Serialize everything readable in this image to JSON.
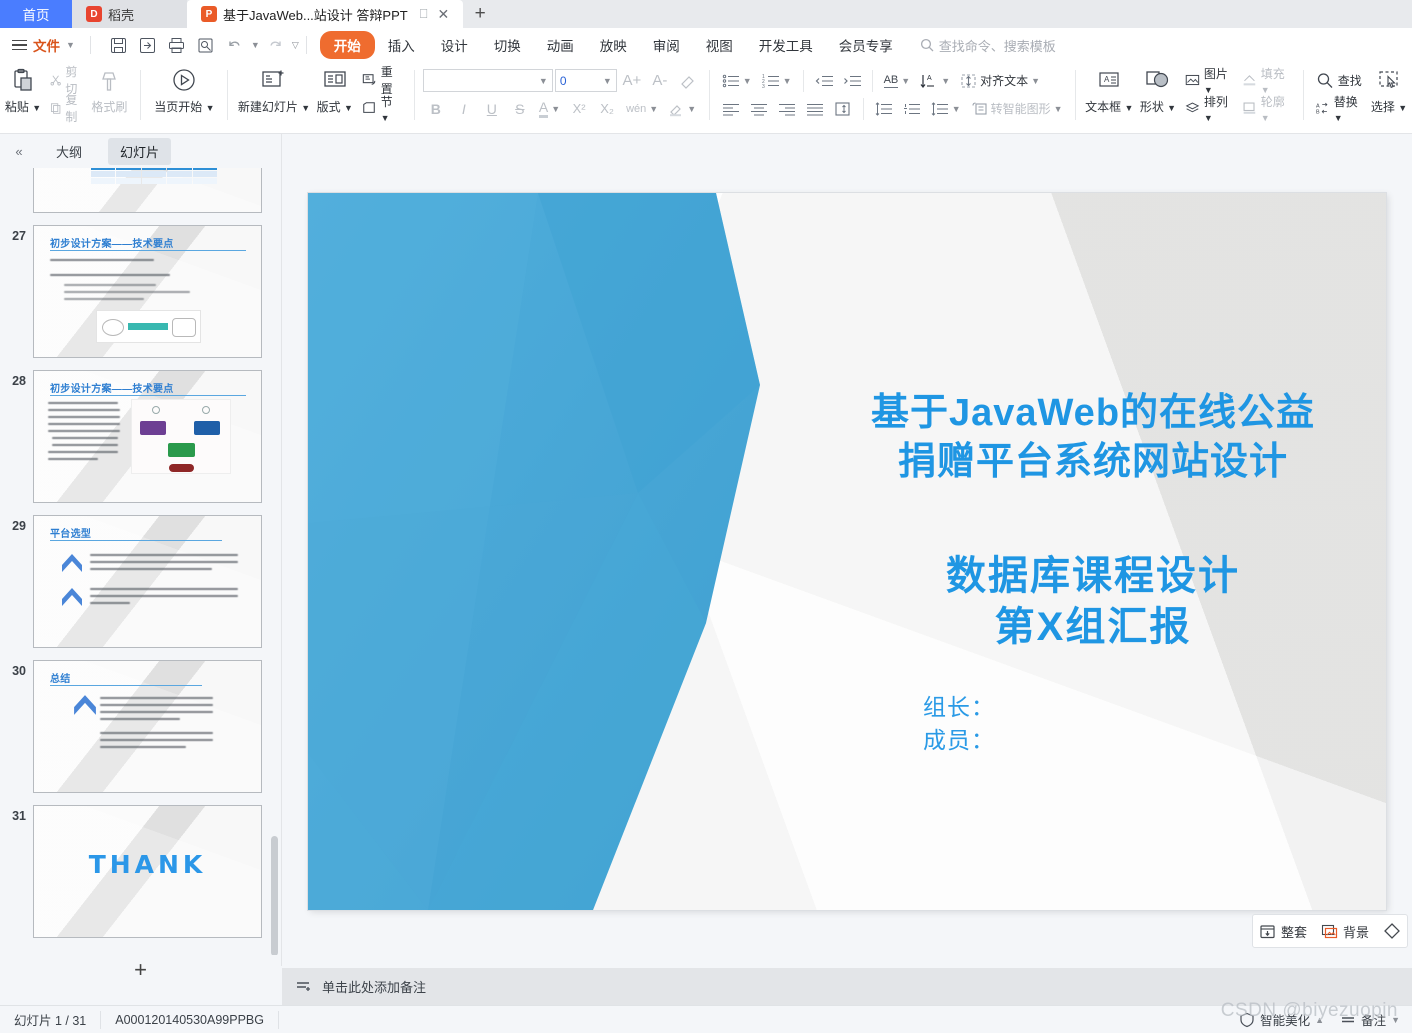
{
  "tabs": {
    "home_label": "首页",
    "docer_label": "稻壳",
    "doc_label": "基于JavaWeb...站设计 答辩PPT",
    "new_tab_label": "+"
  },
  "menubar": {
    "file_label": "文件",
    "quick_access": [
      "save-icon",
      "save-as-icon",
      "print-icon",
      "print-preview-icon",
      "undo-icon",
      "redo-icon",
      "customize-icon"
    ],
    "items": [
      "开始",
      "插入",
      "设计",
      "切换",
      "动画",
      "放映",
      "审阅",
      "视图",
      "开发工具",
      "会员专享"
    ],
    "active_item": "开始",
    "search_placeholder": "查找命令、搜索模板"
  },
  "ribbon": {
    "clipboard": {
      "paste": "粘贴",
      "cut": "剪切",
      "copy": "复制",
      "format_painter": "格式刷"
    },
    "start_show": "当页开始",
    "slides": {
      "new_slide": "新建幻灯片",
      "layout": "版式",
      "reset": "重置",
      "section": "节"
    },
    "font": {
      "font_name": "",
      "font_size": "0",
      "grow": "A+",
      "shrink": "A-",
      "clear_format": "clear-format-icon",
      "bold": "B",
      "italic": "I",
      "underline": "U",
      "strike": "S",
      "font_color": "A",
      "superscript": "X²",
      "subscript": "X₂",
      "pinyin": "wén",
      "highlight": "highlight-icon"
    },
    "paragraph": {
      "bullets": "bullet-list-icon",
      "numbering": "numbered-list-icon",
      "dec_indent": "decrease-indent-icon",
      "inc_indent": "increase-indent-icon",
      "text_direction": "AB",
      "sort": "sort-icon",
      "align_text": "对齐文本",
      "align_left": "align-left-icon",
      "align_center": "align-center-icon",
      "align_right": "align-right-icon",
      "justify": "justify-icon",
      "columns": "columns-icon",
      "line_spacing": "line-spacing-icon",
      "para_spacing": "paragraph-spacing-icon",
      "spacing_more": "spacing-options-icon",
      "smart_art": "转智能图形"
    },
    "insert": {
      "textbox": "文本框",
      "shape": "形状",
      "picture": "图片",
      "arrange": "排列",
      "fill": "填充",
      "outline": "轮廓"
    },
    "editing": {
      "find": "查找",
      "replace": "替换",
      "select": "选择"
    }
  },
  "panel": {
    "collapse_icon": "«",
    "outline_tab": "大纲",
    "slides_tab": "幻灯片",
    "active_tab": "幻灯片",
    "add_slide_label": "+"
  },
  "thumbnails": [
    {
      "number": "",
      "title": "",
      "kind": "table-partial"
    },
    {
      "number": "27",
      "title": "初步设计方案——技术要点",
      "kind": "text-diagram"
    },
    {
      "number": "28",
      "title": "初步设计方案——技术要点",
      "kind": "text-image"
    },
    {
      "number": "29",
      "title": "平台选型",
      "kind": "bullets"
    },
    {
      "number": "30",
      "title": "总结",
      "kind": "bullets"
    },
    {
      "number": "31",
      "title": "THANK",
      "kind": "thanks"
    }
  ],
  "slide": {
    "title_line1": "基于JavaWeb的在线公益",
    "title_line2": "捐赠平台系统网站设计",
    "subtitle_line1": "数据库课程设计",
    "subtitle_line2": "第X组汇报",
    "leader_label": "组长：",
    "members_label": "成员：",
    "accent_color": "#1f96e3",
    "shape_color": "#4ba8d8"
  },
  "float_buttons": {
    "whole_set": "整套",
    "background": "背景",
    "shape_tool": "shape-tool-icon"
  },
  "notes": {
    "placeholder": "单击此处添加备注",
    "icon": "add-note-icon"
  },
  "status": {
    "slide_count": "幻灯片 1 / 31",
    "doc_id": "A000120140530A99PPBG",
    "smart_beautify": "智能美化",
    "notes_toggle": "备注",
    "watermark": "CSDN @biyezuopin"
  }
}
